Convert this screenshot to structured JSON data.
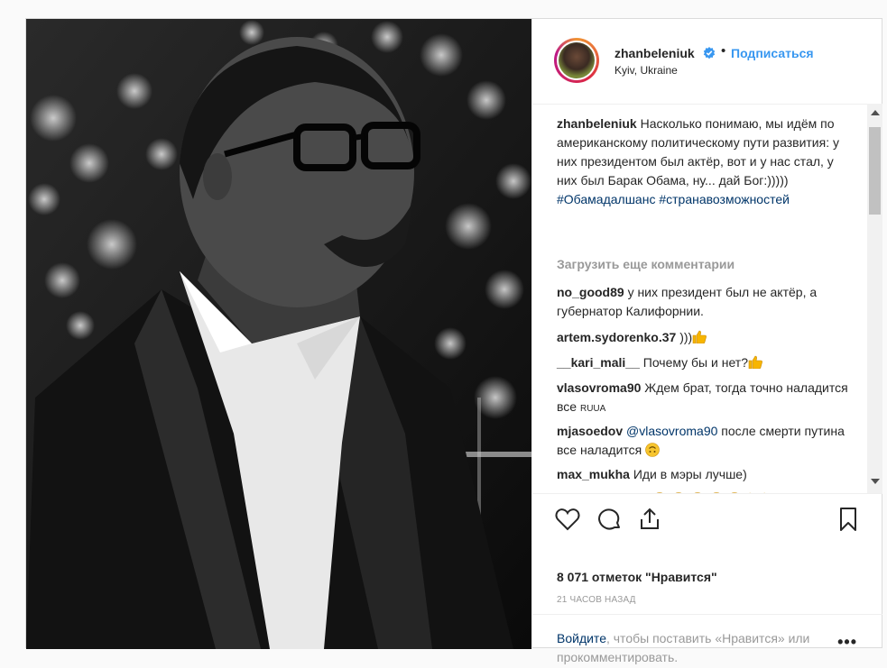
{
  "post": {
    "username": "zhanbeleniuk",
    "follow_label": "Подписаться",
    "dot": "•",
    "location": "Kyiv, Ukraine",
    "caption": {
      "user": "zhanbeleniuk",
      "text": "Насколько понимаю, мы идём по американскому политическому пути развития: у них президентом был актёр, вот и у нас стал, у них был Барак Обама, ну... дай Бог:)))))",
      "hashtag1": "#Обамадалшанс",
      "hashtag2": "#странавозможностей"
    },
    "load_more": "Загрузить еще комментарии",
    "comments": [
      {
        "user": "no_good89",
        "text": "у них президент был не актёр, а губернатор Калифорнии."
      },
      {
        "user": "artem.sydorenko.37",
        "text": ")))"
      },
      {
        "user": "__kari_mali__",
        "text": "Почему бы и нет?"
      },
      {
        "user": "vlasovroma90",
        "text": "Ждем брат, тогда точно наладится все",
        "suffix": "RUUA"
      },
      {
        "user": "mjasoedov",
        "mention": "@vlasovroma90",
        "text": "после смерти путина все наладится"
      },
      {
        "user": "max_mukha",
        "text": "Иди в мэры лучше)"
      },
      {
        "user": "maksimperchik",
        "text": ""
      }
    ],
    "likes": "8 071 отметок \"Нравится\"",
    "time": "21 ЧАСОВ НАЗАД",
    "login_link": "Войдите",
    "login_text": ", чтобы поставить «Нравится» или прокомментировать.",
    "more": "•••"
  },
  "icons": [
    "verified-badge-icon",
    "heart-icon",
    "comment-icon",
    "share-icon",
    "bookmark-icon",
    "thumbs-up-emoji",
    "laughing-emoji",
    "upside-down-emoji",
    "more-options-icon"
  ],
  "colors": {
    "accent": "#3897f0",
    "text": "#262626",
    "muted": "#999999",
    "link": "#003569",
    "border": "#dbdbdb"
  }
}
